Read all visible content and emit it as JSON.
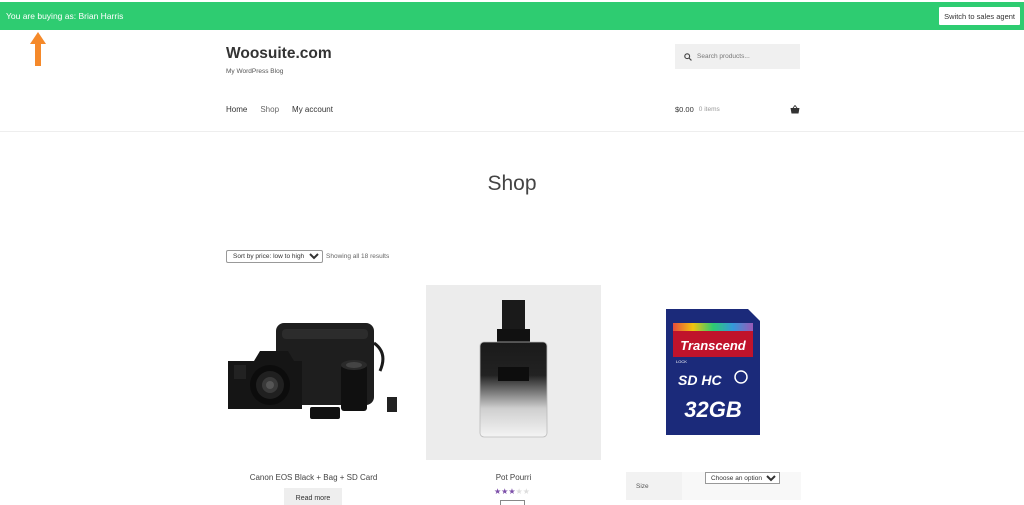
{
  "topbar": {
    "buying_as": "You are buying as: Brian Harris",
    "switch_label": "Switch to sales agent",
    "color": "#2ecc71"
  },
  "annotation": {
    "arrow_color": "#f5892a"
  },
  "header": {
    "site_title": "Woosuite.com",
    "tagline": "My WordPress Blog",
    "search_placeholder": "Search products...",
    "nav": [
      "Home",
      "Shop",
      "My account"
    ],
    "cart_total": "$0.00",
    "cart_count": "0 items"
  },
  "main": {
    "page_title": "Shop",
    "sort_selected": "Sort by price: low to high",
    "results_text": "Showing all 18 results"
  },
  "products": [
    {
      "name": "Canon EOS Black + Bag + SD Card",
      "button": "Read more"
    },
    {
      "name": "Pot Pourri",
      "rating": 3,
      "rating_max": 5
    },
    {
      "variation_label": "Size",
      "variation_select": "Choose an option",
      "card_brand": "Transcend",
      "card_capacity": "32GB",
      "card_lock": "LOCK"
    }
  ]
}
